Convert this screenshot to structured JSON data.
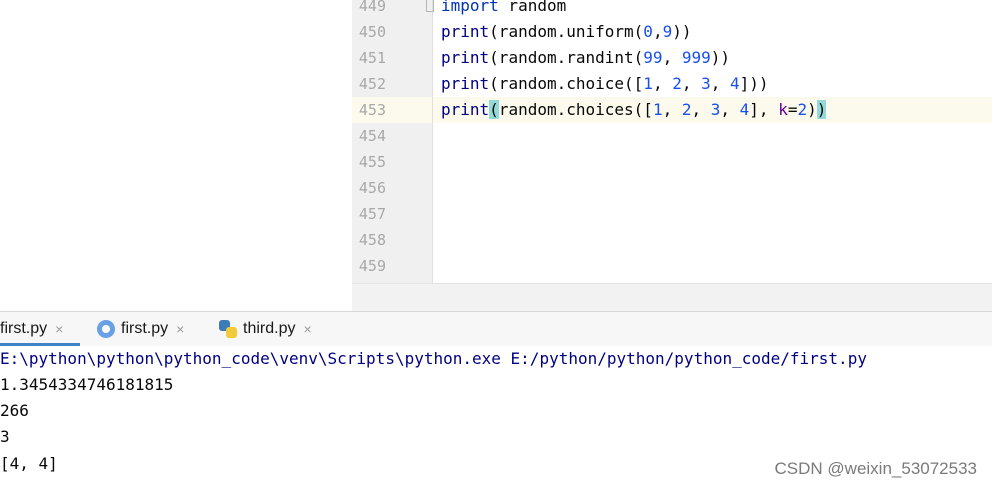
{
  "editor": {
    "line_numbers": [
      "449",
      "450",
      "451",
      "452",
      "453",
      "454",
      "455",
      "456",
      "457",
      "458",
      "459"
    ],
    "lines": {
      "l449": {
        "kw": "import",
        "rest": " random"
      },
      "l450": {
        "fn": "print",
        "a": "(random.uniform(",
        "n1": "0",
        "c": ",",
        "n2": "9",
        "e": "))"
      },
      "l451": {
        "fn": "print",
        "a": "(random.randint(",
        "n1": "99",
        "c": ", ",
        "n2": "999",
        "e": "))"
      },
      "l452": {
        "fn": "print",
        "a": "(random.choice([",
        "n1": "1",
        "c1": ", ",
        "n2": "2",
        "c2": ", ",
        "n3": "3",
        "c3": ", ",
        "n4": "4",
        "e": "]))"
      },
      "l453": {
        "fn": "print",
        "open": "(",
        "a": "random.choices([",
        "n1": "1",
        "c1": ", ",
        "n2": "2",
        "c2": ", ",
        "n3": "3",
        "c3": ", ",
        "n4": "4",
        "b": "], ",
        "kname": "k",
        "eq": "=",
        "kval": "2",
        "c": ")",
        "close": ")"
      }
    }
  },
  "tabs": [
    {
      "label": "first.py",
      "icon": "none"
    },
    {
      "label": "first.py",
      "icon": "gear-icon"
    },
    {
      "label": "third.py",
      "icon": "python-icon"
    }
  ],
  "tab_close": "×",
  "console": {
    "command": "E:\\python\\python\\python_code\\venv\\Scripts\\python.exe E:/python/python/python_code/first.py",
    "outputs": [
      "1.3454334746181815",
      "266",
      "3",
      "[4, 4]"
    ]
  },
  "watermark": "CSDN @weixin_53072533",
  "colors": {
    "keyword": "#0033b3",
    "number": "#1750eb",
    "param": "#660099",
    "brace_highlight": "#93d9d9",
    "current_line": "#fcfaed",
    "tab_underline": "#4083c9"
  }
}
